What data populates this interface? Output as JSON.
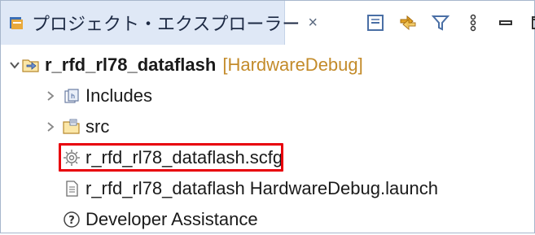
{
  "view": {
    "title": "プロジェクト・エクスプローラー",
    "title_icon": "project-explorer-icon",
    "close_glyph": "×"
  },
  "toolbar": {
    "items": [
      "collapse-all-icon",
      "link-with-editor-icon",
      "filter-icon",
      "view-menu-icon",
      "minimize-icon",
      "maximize-icon"
    ]
  },
  "tree": {
    "project": {
      "name": "r_rfd_rl78_dataflash",
      "decoration": "[HardwareDebug]",
      "expanded": true
    },
    "children": [
      {
        "label": "Includes",
        "icon": "includes-icon",
        "expandable": true
      },
      {
        "label": "src",
        "icon": "source-folder-icon",
        "expandable": true
      },
      {
        "label": "r_rfd_rl78_dataflash.scfg",
        "icon": "gear-file-icon",
        "expandable": false,
        "highlighted": true
      },
      {
        "label": "r_rfd_rl78_dataflash HardwareDebug.launch",
        "icon": "launch-file-icon",
        "expandable": false
      },
      {
        "label": "Developer Assistance",
        "icon": "help-icon",
        "expandable": false
      }
    ]
  },
  "colors": {
    "tab_background": "#dfe8f6",
    "highlight_border": "#e8000b",
    "decoration_text": "#c38b2a"
  }
}
